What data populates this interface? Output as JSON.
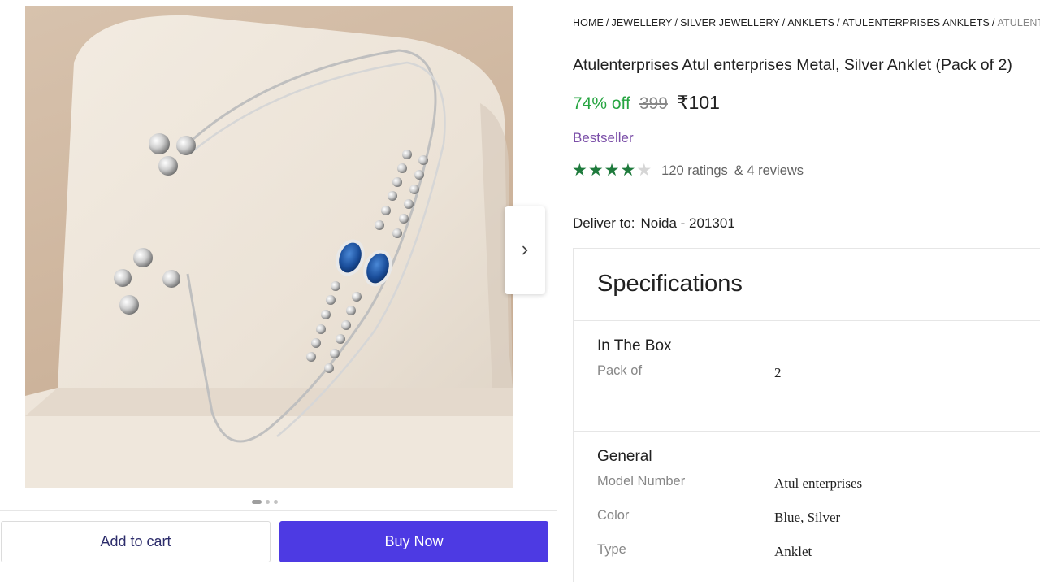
{
  "breadcrumb": [
    {
      "label": "HOME"
    },
    {
      "label": "JEWELLERY"
    },
    {
      "label": "SILVER JEWELLERY"
    },
    {
      "label": "ANKLETS"
    },
    {
      "label": "ATULENTERPRISES ANKLETS"
    },
    {
      "label": "ATULENTERPR"
    }
  ],
  "product": {
    "title": "Atulenterprises Atul enterprises Metal, Silver Anklet (Pack of 2)",
    "discount": "74% off",
    "mrp": "399",
    "price": "₹101",
    "badge": "Bestseller",
    "rating": {
      "stars_filled": 4,
      "stars_total": 5,
      "ratings_text": "120 ratings",
      "reviews_text": "& 4 reviews"
    }
  },
  "delivery": {
    "label": "Deliver to:",
    "location": "Noida - 201301"
  },
  "gallery": {
    "image_count": 3,
    "active_index": 0,
    "next_icon": "chevron-right-icon"
  },
  "actions": {
    "add_to_cart": "Add to cart",
    "buy_now": "Buy Now"
  },
  "specifications": {
    "title": "Specifications",
    "groups": [
      {
        "title": "In The Box",
        "rows": [
          {
            "key": "Pack of",
            "value": "2"
          }
        ]
      },
      {
        "title": "General",
        "rows": [
          {
            "key": "Model Number",
            "value": "Atul enterprises"
          },
          {
            "key": "Color",
            "value": "Blue, Silver"
          },
          {
            "key": "Type",
            "value": "Anklet"
          }
        ]
      }
    ]
  },
  "colors": {
    "discount_green": "#26a541",
    "star_green": "#1e7a3c",
    "bestseller_purple": "#7b4fa8",
    "buy_now_bg": "#4d3ae3"
  }
}
